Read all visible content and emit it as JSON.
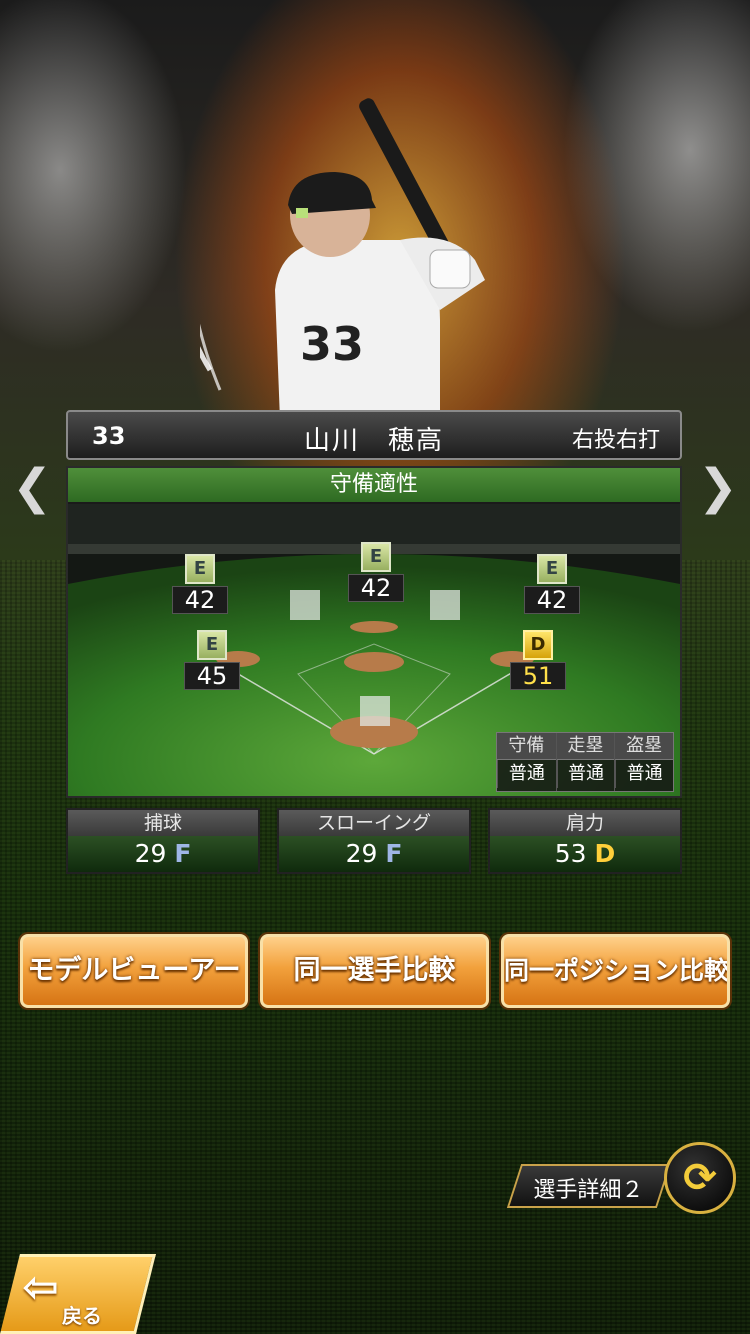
{
  "player": {
    "number": "33",
    "name": "山川　穂高",
    "hand": "右投右打"
  },
  "nav": {
    "prev_icon": "chevron-left-icon",
    "next_icon": "chevron-right-icon",
    "prev_glyph": "❮",
    "next_glyph": "❯"
  },
  "defense": {
    "title": "守備適性",
    "positions": [
      {
        "id": "left",
        "grade": "E",
        "value": "42"
      },
      {
        "id": "center",
        "grade": "E",
        "value": "42"
      },
      {
        "id": "right",
        "grade": "E",
        "value": "42"
      },
      {
        "id": "third",
        "grade": "E",
        "value": "45"
      },
      {
        "id": "first",
        "grade": "D",
        "value": "51"
      }
    ],
    "running": {
      "headers": [
        "守備",
        "走塁",
        "盗塁"
      ],
      "values": [
        "普通",
        "普通",
        "普通"
      ]
    }
  },
  "stats": [
    {
      "label": "捕球",
      "value": "29",
      "grade": "F"
    },
    {
      "label": "スローイング",
      "value": "29",
      "grade": "F"
    },
    {
      "label": "肩力",
      "value": "53",
      "grade": "D"
    }
  ],
  "buttons": {
    "model_viewer": "モデルビューアー",
    "same_player_compare": "同一選手比較",
    "same_position_compare": "同一ポジション比較"
  },
  "detail": {
    "label": "選手詳細２",
    "swap_glyph": "⟳"
  },
  "back": {
    "label": "戻る",
    "glyph": "⇦"
  },
  "colors": {
    "accent_orange": "#f2a13c",
    "panel_green": "#4f8f3a",
    "grade_d_gold": "#ffcf3a",
    "grade_f_blue": "#9fb6e6"
  }
}
